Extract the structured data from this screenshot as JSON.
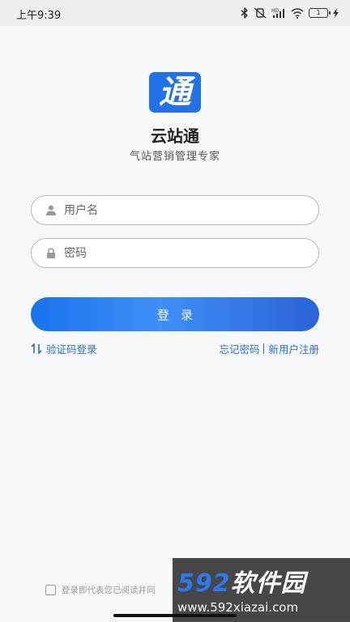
{
  "status_bar": {
    "time": "上午9:39",
    "battery": "1"
  },
  "app": {
    "logo_char": "通",
    "name": "云站通",
    "slogan": "气站营销管理专家",
    "brand_color": "#2371e7"
  },
  "form": {
    "username_placeholder": "用户名",
    "password_placeholder": "密码",
    "login_label": "登录"
  },
  "links": {
    "switch_login": "验证码登录",
    "forgot_password": "忘记密码",
    "register": "新用户注册",
    "link_color": "#2a6fd6"
  },
  "agreement": {
    "text": "登录即代表您已阅读并同",
    "checked": false
  },
  "watermark": {
    "digits": "592",
    "text": "软件园",
    "url": "www.592xiazai.com"
  }
}
